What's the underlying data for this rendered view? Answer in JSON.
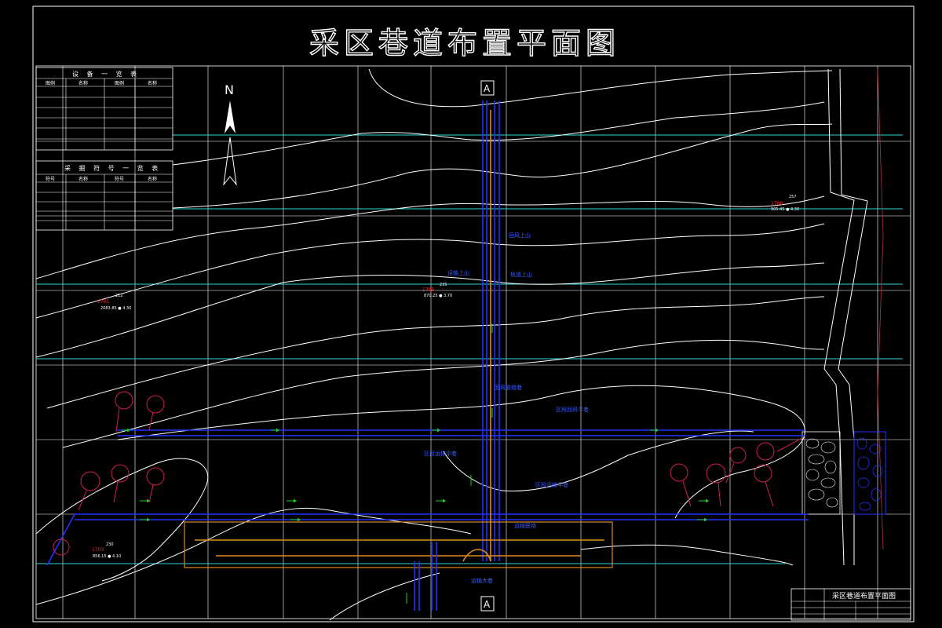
{
  "title": "采区巷道布置平面图",
  "north_label": "N",
  "section_mark_top": "A",
  "section_mark_bottom": "A",
  "equipment_table": {
    "heading": "设 备 一 览 表",
    "col_headers": [
      "图例",
      "名称",
      "图例",
      "名称"
    ]
  },
  "ventilation_table": {
    "heading": "采 掘 符 号 一 览 表",
    "col_headers": [
      "符号",
      "名称",
      "符号",
      "名称"
    ]
  },
  "title_block": {
    "drawing_title": "采区巷道布置平面图"
  },
  "colors": {
    "background": "#000000",
    "lines": "#ffffff",
    "roadway": "#2330ff",
    "roadway_orange": "#e08a20",
    "cyan_lines": "#2fd0d8",
    "symbols": "#d0204a",
    "arrows": "#22cc22",
    "drill_marks": "#ff2a2a"
  },
  "icons": [
    "north-arrow-icon",
    "section-marker-icon",
    "equipment-symbol-icon",
    "airflow-arrow-icon",
    "gob-area-icon"
  ]
}
